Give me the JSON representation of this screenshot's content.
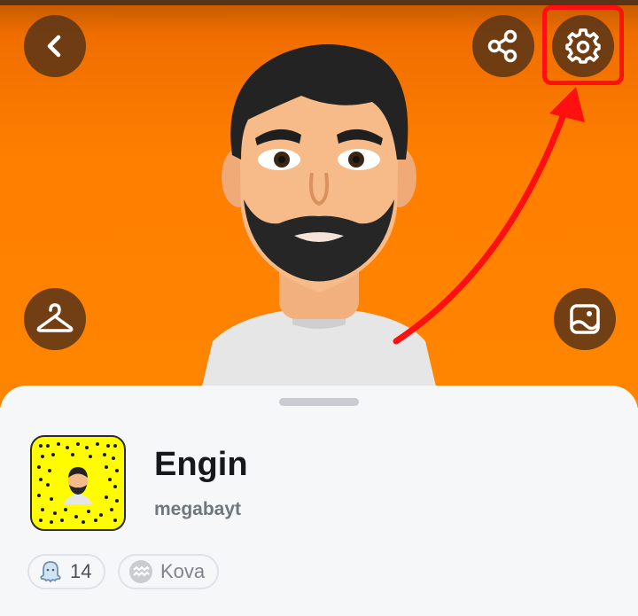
{
  "profile": {
    "display_name": "Engin",
    "username": "megabayt"
  },
  "chips": {
    "friends_count": "14",
    "zodiac": "Kova"
  },
  "icons": {
    "back": "chevron-left-icon",
    "share": "share-icon",
    "settings": "gear-icon",
    "wardrobe": "hanger-icon",
    "selfie": "image-icon",
    "ghost": "ghost-icon",
    "zodiac": "aquarius-icon"
  },
  "colors": {
    "hero_orange": "#ff7f00",
    "button_bg": "#5a3418",
    "highlight_red": "#ff1010",
    "snapcode_yellow": "#fffc00"
  }
}
